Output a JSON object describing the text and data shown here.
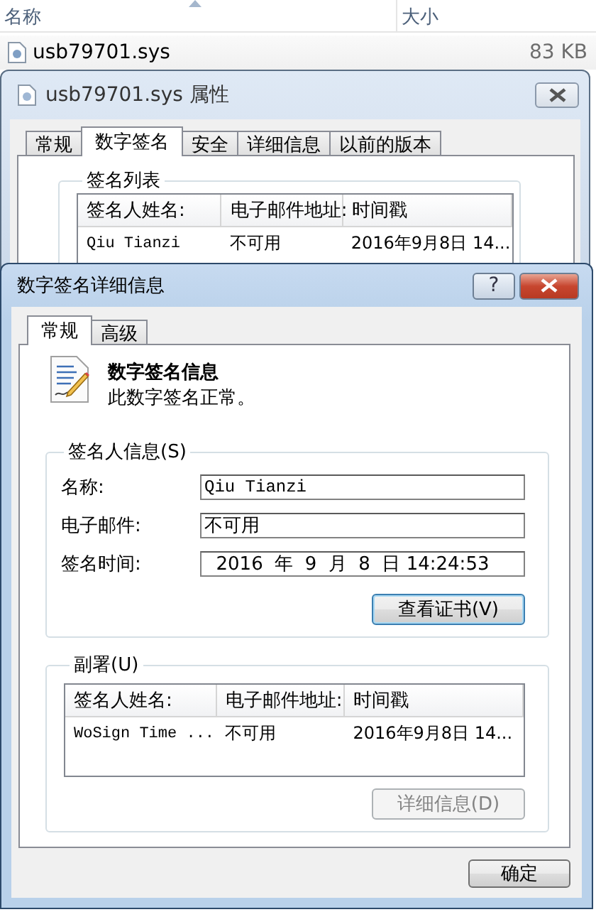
{
  "explorer": {
    "columns": [
      "名称",
      "大小"
    ],
    "file": {
      "name": "usb79701.sys",
      "size": "83 KB"
    }
  },
  "properties": {
    "title": "usb79701.sys 属性",
    "tabs": [
      {
        "label": "常规",
        "selected": false
      },
      {
        "label": "数字签名",
        "selected": true
      },
      {
        "label": "安全",
        "selected": false
      },
      {
        "label": "详细信息",
        "selected": false
      },
      {
        "label": "以前的版本",
        "selected": false
      }
    ],
    "group": "签名列表",
    "list": {
      "columns": [
        "签名人姓名:",
        "电子邮件地址:",
        "时间戳"
      ],
      "rows": [
        [
          "Qiu Tianzi",
          "不可用",
          "2016年9月8日 14..."
        ]
      ]
    }
  },
  "details": {
    "title": "数字签名详细信息",
    "help": "?",
    "tabs": [
      {
        "label": "常规",
        "selected": true
      },
      {
        "label": "高级",
        "selected": false
      }
    ],
    "heading": "数字签名信息",
    "status": "此数字签名正常。",
    "signer": {
      "group": "签名人信息(S)",
      "fields": [
        {
          "label": "名称:",
          "value": "Qiu Tianzi"
        },
        {
          "label": "电子邮件:",
          "value": "不可用"
        },
        {
          "label": "签名时间:",
          "value": "  2016  年  9  月  8  日 14:24:53"
        }
      ],
      "button": "查看证书(V)"
    },
    "countersign": {
      "group": "副署(U)",
      "list": {
        "columns": [
          "签名人姓名:",
          "电子邮件地址:",
          "时间戳"
        ],
        "rows": [
          [
            "WoSign Time ...",
            "不可用",
            "2016年9月8日 14..."
          ]
        ]
      },
      "button": {
        "label": "详细信息(D)",
        "disabled": true
      }
    },
    "ok": "确定"
  }
}
